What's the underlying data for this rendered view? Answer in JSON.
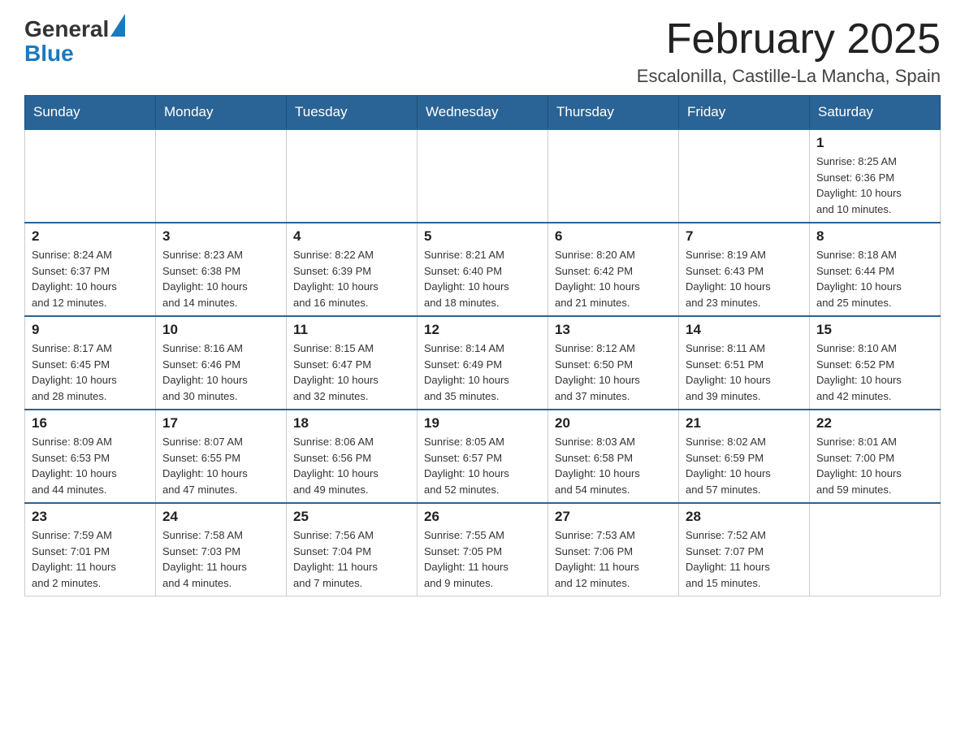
{
  "header": {
    "logo": {
      "general": "General",
      "blue": "Blue"
    },
    "title": "February 2025",
    "location": "Escalonilla, Castille-La Mancha, Spain"
  },
  "days_of_week": [
    "Sunday",
    "Monday",
    "Tuesday",
    "Wednesday",
    "Thursday",
    "Friday",
    "Saturday"
  ],
  "weeks": [
    [
      {
        "day": "",
        "info": ""
      },
      {
        "day": "",
        "info": ""
      },
      {
        "day": "",
        "info": ""
      },
      {
        "day": "",
        "info": ""
      },
      {
        "day": "",
        "info": ""
      },
      {
        "day": "",
        "info": ""
      },
      {
        "day": "1",
        "info": "Sunrise: 8:25 AM\nSunset: 6:36 PM\nDaylight: 10 hours\nand 10 minutes."
      }
    ],
    [
      {
        "day": "2",
        "info": "Sunrise: 8:24 AM\nSunset: 6:37 PM\nDaylight: 10 hours\nand 12 minutes."
      },
      {
        "day": "3",
        "info": "Sunrise: 8:23 AM\nSunset: 6:38 PM\nDaylight: 10 hours\nand 14 minutes."
      },
      {
        "day": "4",
        "info": "Sunrise: 8:22 AM\nSunset: 6:39 PM\nDaylight: 10 hours\nand 16 minutes."
      },
      {
        "day": "5",
        "info": "Sunrise: 8:21 AM\nSunset: 6:40 PM\nDaylight: 10 hours\nand 18 minutes."
      },
      {
        "day": "6",
        "info": "Sunrise: 8:20 AM\nSunset: 6:42 PM\nDaylight: 10 hours\nand 21 minutes."
      },
      {
        "day": "7",
        "info": "Sunrise: 8:19 AM\nSunset: 6:43 PM\nDaylight: 10 hours\nand 23 minutes."
      },
      {
        "day": "8",
        "info": "Sunrise: 8:18 AM\nSunset: 6:44 PM\nDaylight: 10 hours\nand 25 minutes."
      }
    ],
    [
      {
        "day": "9",
        "info": "Sunrise: 8:17 AM\nSunset: 6:45 PM\nDaylight: 10 hours\nand 28 minutes."
      },
      {
        "day": "10",
        "info": "Sunrise: 8:16 AM\nSunset: 6:46 PM\nDaylight: 10 hours\nand 30 minutes."
      },
      {
        "day": "11",
        "info": "Sunrise: 8:15 AM\nSunset: 6:47 PM\nDaylight: 10 hours\nand 32 minutes."
      },
      {
        "day": "12",
        "info": "Sunrise: 8:14 AM\nSunset: 6:49 PM\nDaylight: 10 hours\nand 35 minutes."
      },
      {
        "day": "13",
        "info": "Sunrise: 8:12 AM\nSunset: 6:50 PM\nDaylight: 10 hours\nand 37 minutes."
      },
      {
        "day": "14",
        "info": "Sunrise: 8:11 AM\nSunset: 6:51 PM\nDaylight: 10 hours\nand 39 minutes."
      },
      {
        "day": "15",
        "info": "Sunrise: 8:10 AM\nSunset: 6:52 PM\nDaylight: 10 hours\nand 42 minutes."
      }
    ],
    [
      {
        "day": "16",
        "info": "Sunrise: 8:09 AM\nSunset: 6:53 PM\nDaylight: 10 hours\nand 44 minutes."
      },
      {
        "day": "17",
        "info": "Sunrise: 8:07 AM\nSunset: 6:55 PM\nDaylight: 10 hours\nand 47 minutes."
      },
      {
        "day": "18",
        "info": "Sunrise: 8:06 AM\nSunset: 6:56 PM\nDaylight: 10 hours\nand 49 minutes."
      },
      {
        "day": "19",
        "info": "Sunrise: 8:05 AM\nSunset: 6:57 PM\nDaylight: 10 hours\nand 52 minutes."
      },
      {
        "day": "20",
        "info": "Sunrise: 8:03 AM\nSunset: 6:58 PM\nDaylight: 10 hours\nand 54 minutes."
      },
      {
        "day": "21",
        "info": "Sunrise: 8:02 AM\nSunset: 6:59 PM\nDaylight: 10 hours\nand 57 minutes."
      },
      {
        "day": "22",
        "info": "Sunrise: 8:01 AM\nSunset: 7:00 PM\nDaylight: 10 hours\nand 59 minutes."
      }
    ],
    [
      {
        "day": "23",
        "info": "Sunrise: 7:59 AM\nSunset: 7:01 PM\nDaylight: 11 hours\nand 2 minutes."
      },
      {
        "day": "24",
        "info": "Sunrise: 7:58 AM\nSunset: 7:03 PM\nDaylight: 11 hours\nand 4 minutes."
      },
      {
        "day": "25",
        "info": "Sunrise: 7:56 AM\nSunset: 7:04 PM\nDaylight: 11 hours\nand 7 minutes."
      },
      {
        "day": "26",
        "info": "Sunrise: 7:55 AM\nSunset: 7:05 PM\nDaylight: 11 hours\nand 9 minutes."
      },
      {
        "day": "27",
        "info": "Sunrise: 7:53 AM\nSunset: 7:06 PM\nDaylight: 11 hours\nand 12 minutes."
      },
      {
        "day": "28",
        "info": "Sunrise: 7:52 AM\nSunset: 7:07 PM\nDaylight: 11 hours\nand 15 minutes."
      },
      {
        "day": "",
        "info": ""
      }
    ]
  ]
}
